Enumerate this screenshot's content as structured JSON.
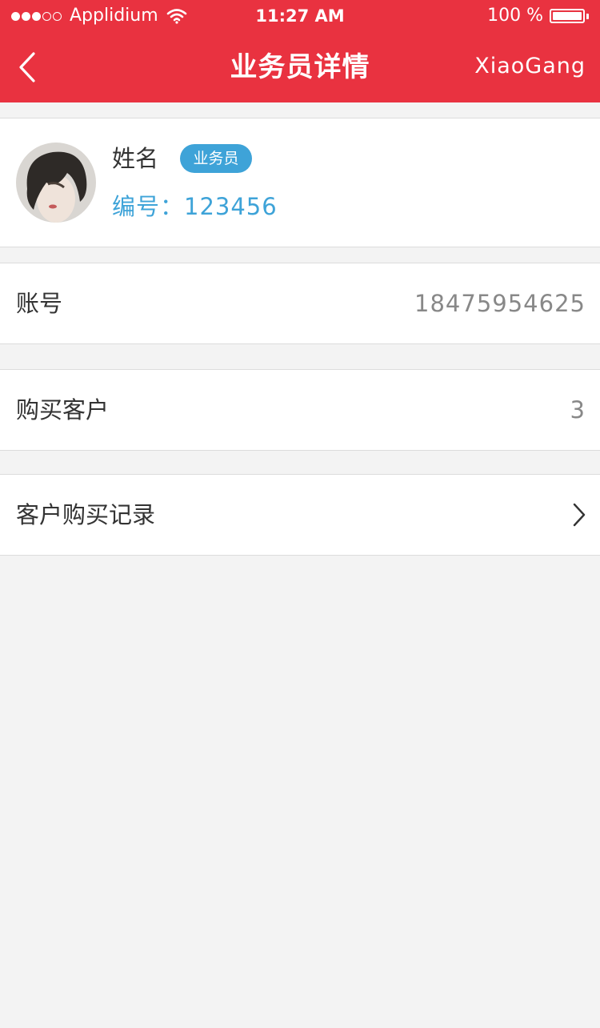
{
  "status_bar": {
    "carrier": "Applidium",
    "time": "11:27 AM",
    "battery": "100 %",
    "signal_dots_filled": 3,
    "signal_dots_total": 5,
    "battery_level": 1.0
  },
  "navbar": {
    "title": "业务员详情",
    "right_text": "XiaoGang",
    "back_icon": "chevron-left-icon"
  },
  "profile": {
    "name": "姓名",
    "role_badge": "业务员",
    "employee_id": "编号：123456"
  },
  "rows": [
    {
      "label": "账号",
      "value": "18475954625"
    },
    {
      "label": "购买客户",
      "value": "3"
    },
    {
      "label": "客户购买记录",
      "icon": "chevron-right-icon"
    }
  ],
  "colors": {
    "header": "#e93240",
    "accent": "#3ea3d8",
    "background": "#f3f3f3"
  }
}
